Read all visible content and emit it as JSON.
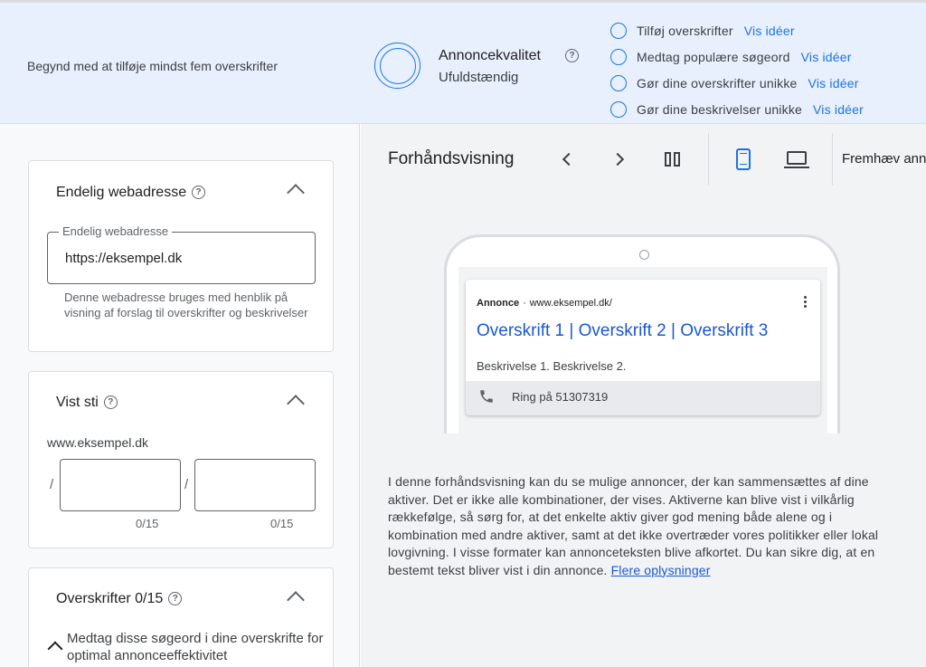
{
  "banner": {
    "message": "Begynd med at tilføje mindst fem overskrifter",
    "quality_title": "Annoncekvalitet",
    "quality_status": "Ufuldstændig",
    "tips": [
      {
        "label": "Tilføj overskrifter",
        "link": "Vis idéer"
      },
      {
        "label": "Medtag populære søgeord",
        "link": "Vis idéer"
      },
      {
        "label": "Gør dine overskrifter unikke",
        "link": "Vis idéer"
      },
      {
        "label": "Gør dine beskrivelser unikke",
        "link": "Vis idéer"
      }
    ]
  },
  "final_url": {
    "title": "Endelig webadresse",
    "field_label": "Endelig webadresse",
    "value": "https://eksempel.dk",
    "hint": "Denne webadresse bruges med henblik på visning af forslag til overskrifter og beskrivelser"
  },
  "display_path": {
    "title": "Vist sti",
    "base": "www.eksempel.dk",
    "separator": "/",
    "counter1": "0/15",
    "counter2": "0/15"
  },
  "headlines": {
    "title": "Overskrifter 0/15",
    "keywords_hint": "Medtag disse søgeord i dine overskrifte for optimal annonceeffektivitet"
  },
  "preview": {
    "title": "Forhåndsvisning",
    "highlight_label": "Fremhæv annonce",
    "ad": {
      "badge": "Annonce",
      "dot": "·",
      "url": "www.eksempel.dk/",
      "headline": "Overskrift 1 | Overskrift 2 | Overskrift 3",
      "description": "Beskrivelse 1. Beskrivelse 2.",
      "call": "Ring på 51307319"
    },
    "note": "I denne forhåndsvisning kan du se mulige annoncer, der kan sammensættes af dine aktiver. Det er ikke alle kombinationer, der vises. Aktiverne kan blive vist i vilkårlig rækkefølge, så sørg for, at det enkelte aktiv giver god mening både alene og i kombination med andre aktiver, samt at det ikke overtræder vores politikker eller lokal lovgivning. I visse formater kan annonceteksten blive afkortet. Du kan sikre dig, at en bestemt tekst bliver vist i din annonce.",
    "more_link": "Flere oplysninger"
  },
  "icons": {
    "help": "?",
    "quality_ring": "ring-icon",
    "mobile": "mobile-icon",
    "desktop": "desktop-icon"
  }
}
